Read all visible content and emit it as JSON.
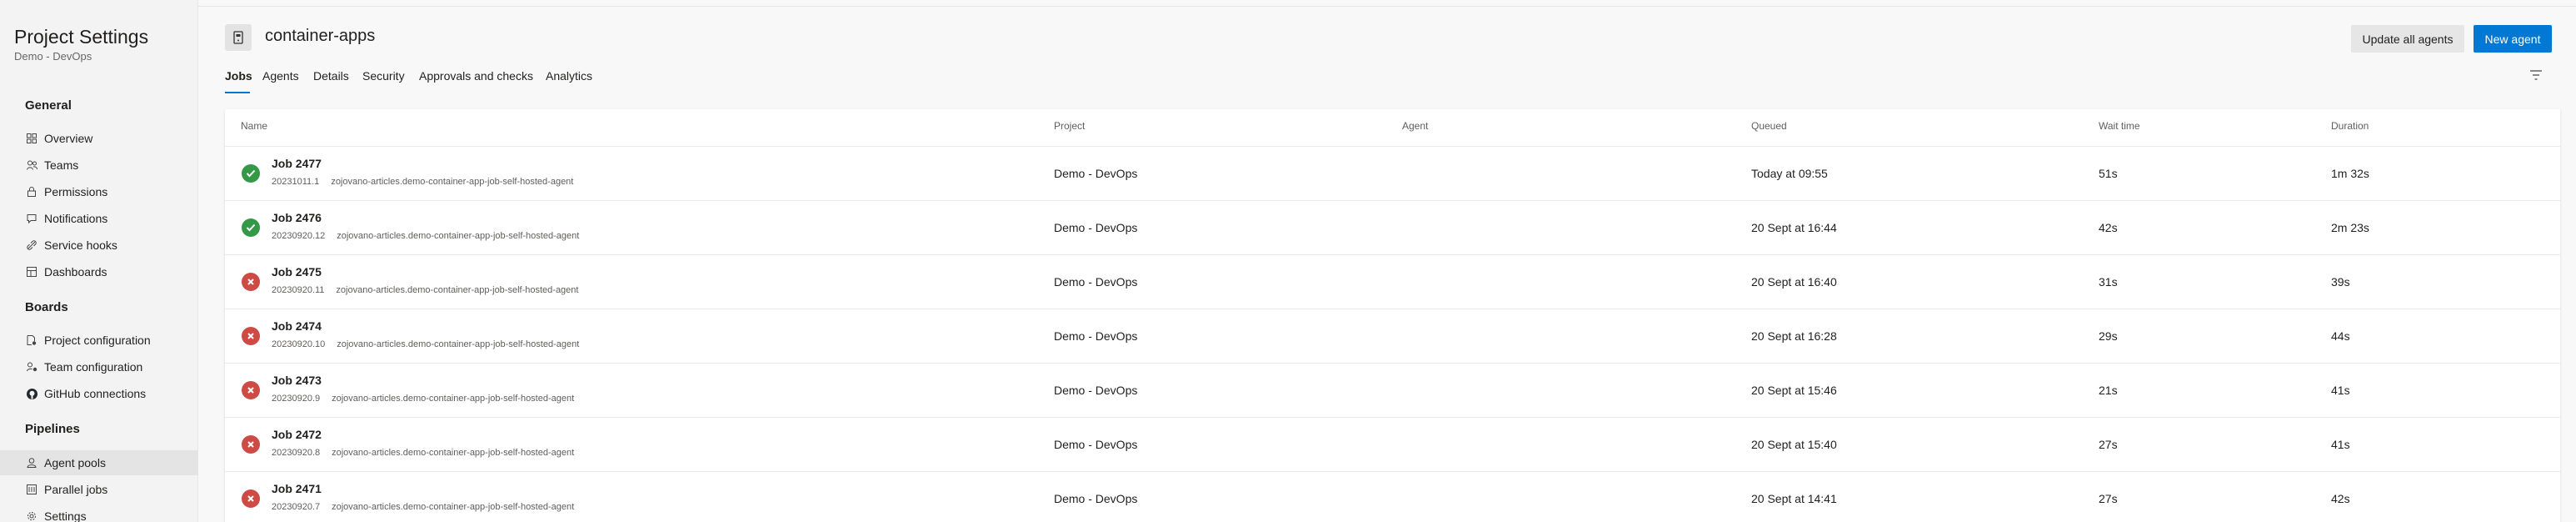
{
  "sidebar": {
    "title": "Project Settings",
    "subtitle": "Demo - DevOps",
    "sections": [
      {
        "label": "General",
        "items": [
          {
            "label": "Overview",
            "icon": "grid-icon"
          },
          {
            "label": "Teams",
            "icon": "people-icon"
          },
          {
            "label": "Permissions",
            "icon": "lock-icon"
          },
          {
            "label": "Notifications",
            "icon": "chat-icon"
          },
          {
            "label": "Service hooks",
            "icon": "link-icon"
          },
          {
            "label": "Dashboards",
            "icon": "dashboard-icon"
          }
        ]
      },
      {
        "label": "Boards",
        "items": [
          {
            "label": "Project configuration",
            "icon": "settings-doc-icon"
          },
          {
            "label": "Team configuration",
            "icon": "team-settings-icon"
          },
          {
            "label": "GitHub connections",
            "icon": "github-icon"
          }
        ]
      },
      {
        "label": "Pipelines",
        "items": [
          {
            "label": "Agent pools",
            "icon": "agent-icon",
            "active": true
          },
          {
            "label": "Parallel jobs",
            "icon": "parallel-icon"
          },
          {
            "label": "Settings",
            "icon": "gear-icon"
          }
        ]
      }
    ]
  },
  "header": {
    "title": "container-apps",
    "update_label": "Update all agents",
    "new_label": "New agent"
  },
  "tabs": [
    "Jobs",
    "Agents",
    "Details",
    "Security",
    "Approvals and checks",
    "Analytics"
  ],
  "table": {
    "columns": [
      "Name",
      "Project",
      "Agent",
      "Queued",
      "Wait time",
      "Duration"
    ],
    "rows": [
      {
        "status": "success",
        "name": "Job 2477",
        "build": "20231011.1",
        "repo": "zojovano-articles.demo-container-app-job-self-hosted-agent",
        "project": "Demo - DevOps",
        "agent": "",
        "queued": "Today at 09:55",
        "wait": "51s",
        "duration": "1m 32s"
      },
      {
        "status": "success",
        "name": "Job 2476",
        "build": "20230920.12",
        "repo": "zojovano-articles.demo-container-app-job-self-hosted-agent",
        "project": "Demo - DevOps",
        "agent": "",
        "queued": "20 Sept at 16:44",
        "wait": "42s",
        "duration": "2m 23s"
      },
      {
        "status": "failed",
        "name": "Job 2475",
        "build": "20230920.11",
        "repo": "zojovano-articles.demo-container-app-job-self-hosted-agent",
        "project": "Demo - DevOps",
        "agent": "",
        "queued": "20 Sept at 16:40",
        "wait": "31s",
        "duration": "39s"
      },
      {
        "status": "failed",
        "name": "Job 2474",
        "build": "20230920.10",
        "repo": "zojovano-articles.demo-container-app-job-self-hosted-agent",
        "project": "Demo - DevOps",
        "agent": "",
        "queued": "20 Sept at 16:28",
        "wait": "29s",
        "duration": "44s"
      },
      {
        "status": "failed",
        "name": "Job 2473",
        "build": "20230920.9",
        "repo": "zojovano-articles.demo-container-app-job-self-hosted-agent",
        "project": "Demo - DevOps",
        "agent": "",
        "queued": "20 Sept at 15:46",
        "wait": "21s",
        "duration": "41s"
      },
      {
        "status": "failed",
        "name": "Job 2472",
        "build": "20230920.8",
        "repo": "zojovano-articles.demo-container-app-job-self-hosted-agent",
        "project": "Demo - DevOps",
        "agent": "",
        "queued": "20 Sept at 15:40",
        "wait": "27s",
        "duration": "41s"
      },
      {
        "status": "failed",
        "name": "Job 2471",
        "build": "20230920.7",
        "repo": "zojovano-articles.demo-container-app-job-self-hosted-agent",
        "project": "Demo - DevOps",
        "agent": "",
        "queued": "20 Sept at 14:41",
        "wait": "27s",
        "duration": "42s"
      }
    ]
  },
  "colors": {
    "accent": "#0078d4",
    "success": "#339947",
    "failed": "#cd4a45"
  }
}
